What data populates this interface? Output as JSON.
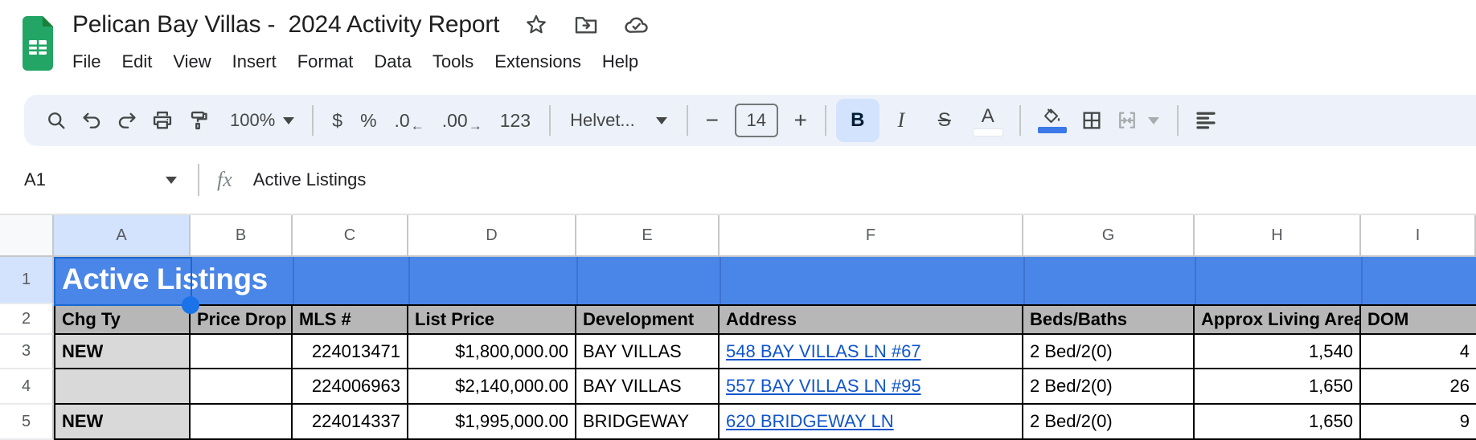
{
  "app": {
    "title": "Pelican Bay Villas -  2024 Activity Report",
    "menu_items": [
      "File",
      "Edit",
      "View",
      "Insert",
      "Format",
      "Data",
      "Tools",
      "Extensions",
      "Help"
    ]
  },
  "toolbar": {
    "zoom": "100%",
    "currency_label": "$",
    "percent_label": "%",
    "decrease_decimal_label": ".0",
    "decrease_decimal_arrow": "←",
    "increase_decimal_label": ".00",
    "increase_decimal_arrow": "→",
    "more_formats_label": "123",
    "font_family": "Helvet...",
    "font_size": "14",
    "minus_label": "−",
    "plus_label": "+",
    "bold_label": "B",
    "italic_label": "I",
    "strikethrough_label": "S",
    "text_color_label": "A"
  },
  "formula_bar": {
    "name_box": "A1",
    "fx_label": "fx",
    "content": "Active Listings"
  },
  "grid": {
    "column_letters": [
      "A",
      "B",
      "C",
      "D",
      "E",
      "F",
      "G",
      "H",
      "I"
    ],
    "row_numbers": [
      "1",
      "2",
      "3",
      "4",
      "5"
    ],
    "title_cell": "Active Listings",
    "header_row": [
      "Chg Ty",
      "Price Drop",
      "MLS #",
      "List Price",
      "Development",
      "Address",
      "Beds/Baths",
      "Approx Living Area",
      "DOM"
    ],
    "rows": [
      {
        "cells": [
          "NEW",
          "",
          "224013471",
          "$1,800,000.00",
          "BAY VILLAS",
          "548 BAY VILLAS LN #67",
          "2 Bed/2(0)",
          "1,540",
          "4"
        ]
      },
      {
        "cells": [
          "",
          "",
          "224006963",
          "$2,140,000.00",
          "BAY VILLAS",
          "557 BAY VILLAS LN #95",
          "2 Bed/2(0)",
          "1,650",
          "26"
        ]
      },
      {
        "cells": [
          "NEW",
          "",
          "224014337",
          "$1,995,000.00",
          "BRIDGEWAY",
          "620 BRIDGEWAY LN",
          "2 Bed/2(0)",
          "1,650",
          "9"
        ]
      }
    ],
    "selected_cell": "A1"
  },
  "colors": {
    "row1_fill": "#4a86e8",
    "table_header_fill": "#b7b7b7",
    "chg_column_fill": "#d9d9d9",
    "link": "#1155cc",
    "selection": "#1a73e8",
    "selected_header_fill": "#d3e3fd",
    "toolbar_fill": "#edf2fa",
    "fill_color_swatch": "#3b78e8",
    "text_color_swatch": "#ffffff"
  }
}
